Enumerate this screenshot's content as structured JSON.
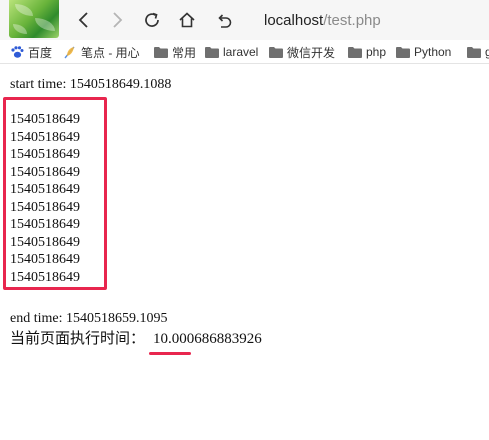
{
  "browser": {
    "address": {
      "host": "localhost",
      "path": "/test.php"
    },
    "bookmarks": [
      {
        "label": "百度",
        "icon": "paw-icon"
      },
      {
        "label": "笔点 - 用心",
        "icon": "feather-icon"
      },
      {
        "label": "常用",
        "icon": "folder-icon"
      },
      {
        "label": "laravel",
        "icon": "folder-icon"
      },
      {
        "label": "微信开发",
        "icon": "folder-icon"
      },
      {
        "label": "php",
        "icon": "folder-icon"
      },
      {
        "label": "Python",
        "icon": "folder-icon"
      },
      {
        "label": "g",
        "icon": "folder-icon"
      }
    ],
    "colors": {
      "toolbar_bg": "#f6f6f6",
      "baidu_blue": "#2f5bd6",
      "folder_gray": "#6f6f6f"
    }
  },
  "page": {
    "start_line": "start time: 1540518649.1088",
    "timestamps": [
      "1540518649",
      "1540518649",
      "1540518649",
      "1540518649",
      "1540518649",
      "1540518649",
      "1540518649",
      "1540518649",
      "1540518649",
      "1540518649"
    ],
    "end_line": "end time: 1540518659.1095",
    "exec_label": "当前页面执行时间：",
    "exec_value": "10.000686883926",
    "annotation_color": "#e8264e"
  }
}
